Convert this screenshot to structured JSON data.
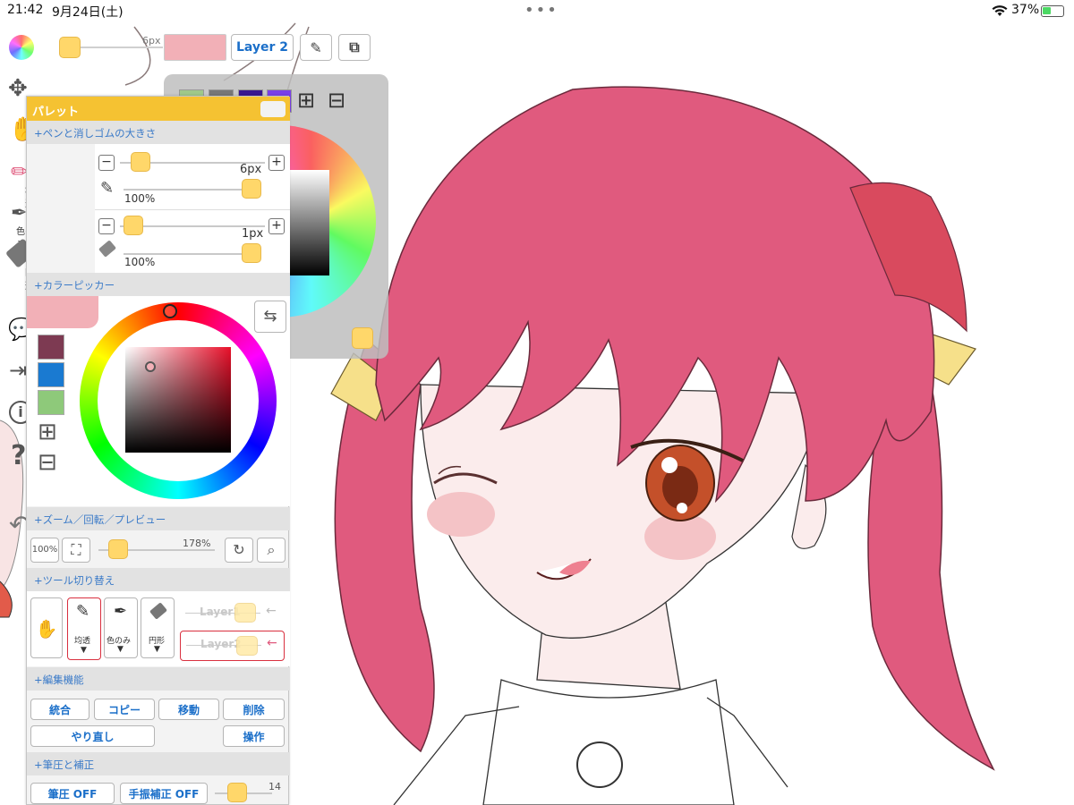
{
  "status": {
    "time": "21:42",
    "date": "9月24日(土)",
    "battery": "37%"
  },
  "toolbar": {
    "size_label": "6px",
    "layer_button": "Layer 2",
    "color_swatch": "#f2b0b7"
  },
  "left_tools": {
    "pen_label": "均透",
    "eyedrop_label": "色のみ",
    "eraser_label": "円形"
  },
  "palette": {
    "title": "パレット",
    "pen_section": "+ペンと消しゴムの大きさ",
    "pen_size": "6px",
    "pen_opacity": "100%",
    "eraser_size": "1px",
    "eraser_opacity": "100%",
    "picker_section": "+カラーピッカー",
    "swatches": [
      "#7d3a52",
      "#1a7ad1",
      "#8ec97a"
    ],
    "zoom_section": "+ズーム／回転／プレビュー",
    "zoom_100": "100%",
    "zoom_value": "178%",
    "tool_section": "+ツール切り替え",
    "tool_labels": [
      "均透",
      "色のみ",
      "円形"
    ],
    "layer1": "Layer1",
    "layer2": "Layer2",
    "edit_section": "+編集機能",
    "edit_buttons": [
      "統合",
      "コピー",
      "移動",
      "削除"
    ],
    "redo": "やり直し",
    "operation": "操作",
    "pressure_section": "+筆圧と補正",
    "pressure_off": "筆圧 OFF",
    "stabilizer_off": "手振補正 OFF",
    "stabilizer_value": "14"
  },
  "colors": {
    "accent": "#f5c232",
    "link": "#1b6fc9",
    "hair": "#e05a7e",
    "alert_red": "#d9303f"
  }
}
